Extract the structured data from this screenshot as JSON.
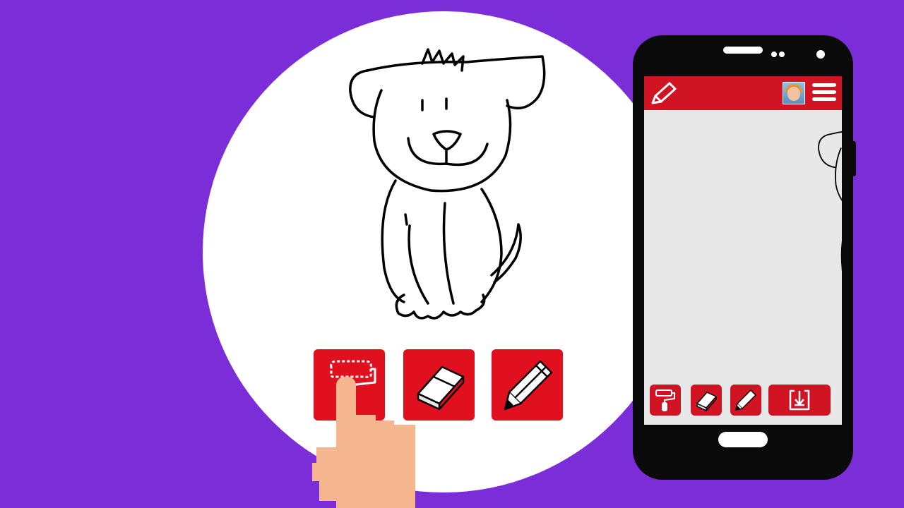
{
  "colors": {
    "background": "#7b2ed8",
    "accent": "#e0101e",
    "skin": "#f5b58e",
    "phone_body": "#0a0a0a",
    "screen_bg": "#e8e8e8"
  },
  "canvas_tools": [
    {
      "name": "paint-roller-button",
      "icon": "paint-roller-icon"
    },
    {
      "name": "eraser-button",
      "icon": "eraser-icon"
    },
    {
      "name": "pencil-button",
      "icon": "pencil-icon"
    }
  ],
  "phone": {
    "header_logo_icon": "marker-icon",
    "avatar": "user-avatar",
    "menu_icon": "hamburger-menu-icon",
    "toolbar": [
      {
        "name": "phone-roller-button",
        "icon": "paint-roller-icon"
      },
      {
        "name": "phone-eraser-button",
        "icon": "eraser-icon"
      },
      {
        "name": "phone-pencil-button",
        "icon": "pencil-icon"
      },
      {
        "name": "phone-save-button",
        "icon": "download-icon"
      }
    ]
  }
}
